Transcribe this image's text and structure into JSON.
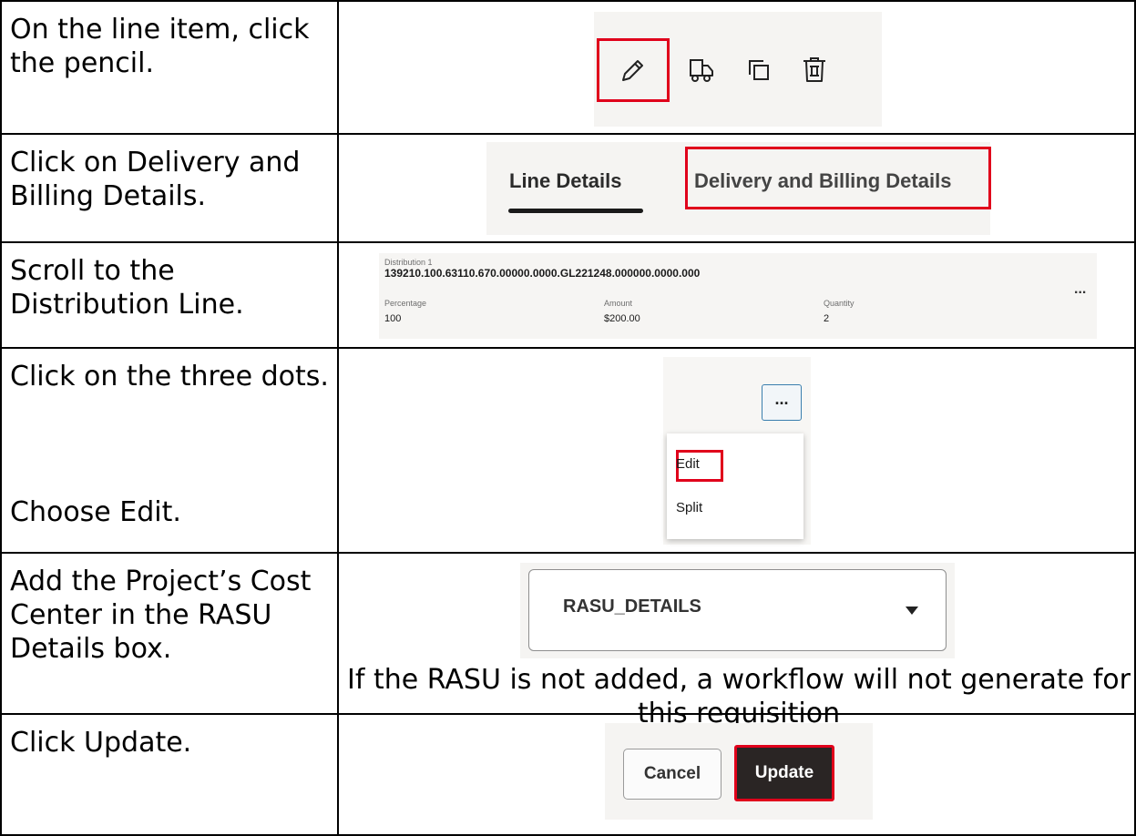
{
  "steps": [
    {
      "instruction": "On the line item, click the pencil."
    },
    {
      "instruction": "Click on Delivery and Billing Details."
    },
    {
      "instruction": "Scroll to the Distribution Line."
    },
    {
      "instruction": "Click on the three dots.",
      "instruction_2": "Choose Edit."
    },
    {
      "instruction": "Add the Project’s Cost Center in the RASU Details box.",
      "note": "If the RASU is not added, a workflow will not generate for this requisition"
    },
    {
      "instruction": "Click Update."
    }
  ],
  "icons": [
    "pencil-icon",
    "truck-icon",
    "duplicate-icon",
    "trash-icon"
  ],
  "tabs": {
    "line_details": "Line Details",
    "delivery_billing": "Delivery and Billing Details"
  },
  "distribution": {
    "heading": "Distribution 1",
    "account": "139210.100.63110.670.00000.0000.GL221248.000000.0000.000",
    "percentage_label": "Percentage",
    "percentage_value": "100",
    "amount_label": "Amount",
    "amount_value": "$200.00",
    "quantity_label": "Quantity",
    "quantity_value": "2",
    "more": "..."
  },
  "menu": {
    "trigger": "...",
    "items": [
      "Edit",
      "Split"
    ]
  },
  "rasu_select": {
    "value": "RASU_DETAILS"
  },
  "buttons": {
    "cancel": "Cancel",
    "update": "Update"
  },
  "colors": {
    "highlight": "#e0001b",
    "grid": "#000000",
    "panel_bg": "#f5f4f2",
    "update_bg": "#2a2524"
  }
}
